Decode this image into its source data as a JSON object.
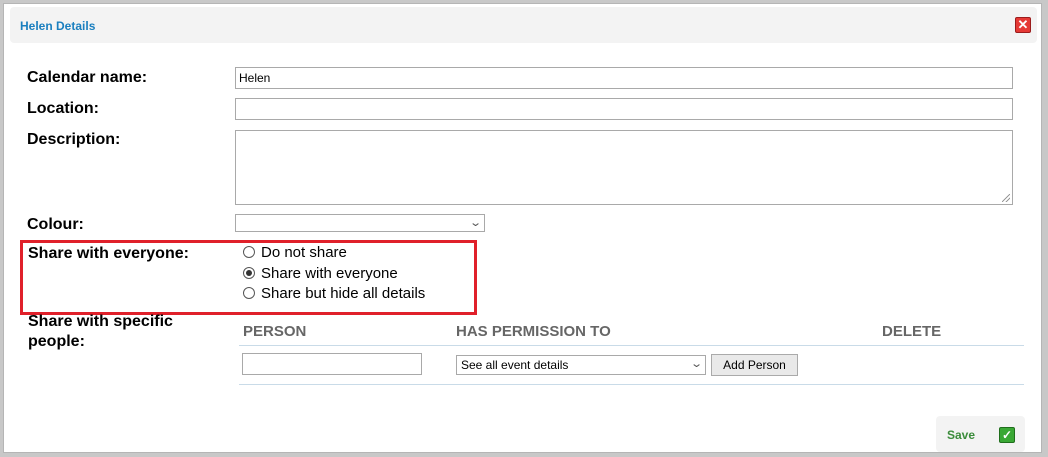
{
  "dialog": {
    "title": "Helen Details",
    "close_glyph": "✕"
  },
  "fields": {
    "calendar_name_label": "Calendar name:",
    "calendar_name_value": "Helen",
    "location_label": "Location:",
    "location_value": "",
    "description_label": "Description:",
    "description_value": "",
    "colour_label": "Colour:",
    "colour_value": ""
  },
  "share_everyone": {
    "label": "Share with everyone:",
    "options": [
      {
        "label": "Do not share",
        "checked": false
      },
      {
        "label": "Share with everyone",
        "checked": true
      },
      {
        "label": "Share but hide all details",
        "checked": false
      }
    ],
    "highlight_color": "#e0202a"
  },
  "share_specific": {
    "label_line1": "Share with specific",
    "label_line2": "people:",
    "columns": [
      "PERSON",
      "HAS PERMISSION TO",
      "DELETE"
    ],
    "person_value": "",
    "permission_value": "See all event details",
    "add_button": "Add Person"
  },
  "footer": {
    "save_label": "Save",
    "save_icon_glyph": "✓"
  },
  "icons": {
    "close": "close-icon",
    "save": "checkmark-icon",
    "dropdown": "chevron-down-icon"
  }
}
